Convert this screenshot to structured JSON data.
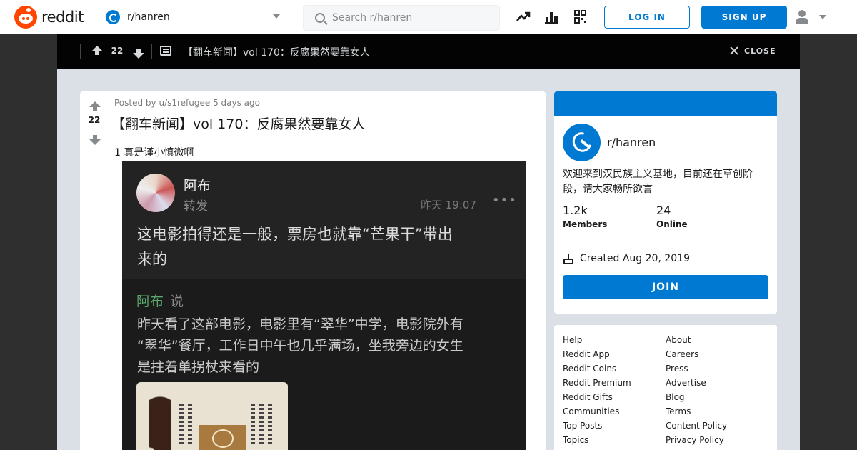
{
  "header": {
    "logo_text": "reddit",
    "community": "r/hanren",
    "search_placeholder": "Search r/hanren",
    "login_label": "LOG IN",
    "signup_label": "SIGN UP",
    "icons": [
      "trending-icon",
      "stats-icon",
      "coins-icon",
      "user-icon",
      "chevron-down-icon"
    ]
  },
  "postbar": {
    "votes": "22",
    "title": "【翻车新闻】vol 170：反腐果然要靠女人",
    "close_label": "CLOSE"
  },
  "post": {
    "meta": "Posted by u/s1refugee 5 days ago",
    "votes": "22",
    "title": "【翻车新闻】vol 170：反腐果然要靠女人",
    "text": "1 真是谨小慎微啊",
    "image": {
      "author": "阿布",
      "action": "转发",
      "time": "昨天 19:07",
      "dots": "•••",
      "lines": [
        "这电影拍得还是一般，票房也就靠“芒果干”带出",
        "来的"
      ],
      "quote_author": "阿布",
      "quote_verb": "说",
      "quote_lines": [
        "昨天看了这部电影，电影里有“翠华”中学，电影院外有",
        "“翠华”餐厅，工作日中午也几乎满场，坐我旁边的女生",
        "是拄着单拐杖来看的"
      ]
    }
  },
  "about": {
    "name": "r/hanren",
    "description": "欢迎来到汉民族主义基地，目前还在草创阶段，请大家畅所欲言",
    "members_value": "1.2k",
    "members_label": "Members",
    "online_value": "24",
    "online_label": "Online",
    "created": "Created Aug 20, 2019",
    "join_label": "JOIN"
  },
  "footer": {
    "left": [
      "Help",
      "Reddit App",
      "Reddit Coins",
      "Reddit Premium",
      "Reddit Gifts",
      "Communities",
      "Top Posts",
      "Topics"
    ],
    "right": [
      "About",
      "Careers",
      "Press",
      "Advertise",
      "Blog",
      "Terms",
      "Content Policy",
      "Privacy Policy"
    ]
  },
  "colors": {
    "brand": "#ff4500",
    "accent": "#0079d3",
    "background": "#dae0e6"
  }
}
